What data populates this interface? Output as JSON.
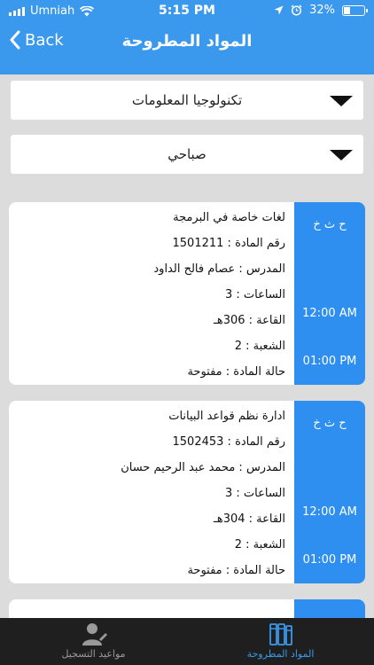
{
  "status_bar": {
    "carrier": "Umniah",
    "time": "5:15 PM",
    "battery": "32%",
    "battery_level": 0.32
  },
  "nav": {
    "back_label": "Back",
    "title": "المواد المطروحة"
  },
  "filters": {
    "department": "تكنولوجيا المعلومات",
    "shift": "صباحي"
  },
  "courses": [
    {
      "name": "لغات خاصة في البرمجة",
      "number": "رقم المادة : 1501211",
      "instructor": "المدرس : عصام فالح الداود",
      "hours": "الساعات : 3",
      "room": "القاعة : 306هـ",
      "section": "الشعبة : 2",
      "status": "حالة المادة : مفتوحة",
      "days": "ح ث خ",
      "start": "12:00 AM",
      "end": "01:00 PM"
    },
    {
      "name": "ادارة نظم قواعد البيانات",
      "number": "رقم المادة : 1502453",
      "instructor": "المدرس : محمد عبد الرحيم حسان",
      "hours": "الساعات : 3",
      "room": "القاعة : 304هـ",
      "section": "الشعبة : 2",
      "status": "حالة المادة : مفتوحة",
      "days": "ح ث خ",
      "start": "12:00 AM",
      "end": "01:00 PM"
    }
  ],
  "tabs": [
    {
      "label": "مواعيد التسجيل",
      "icon": "user-icon"
    },
    {
      "label": "المواد المطروحة",
      "icon": "books-icon",
      "active": true
    }
  ],
  "colors": {
    "accent": "#3a99ec",
    "card_side": "#2f8ff0",
    "tabbar": "#1f1f1f"
  }
}
